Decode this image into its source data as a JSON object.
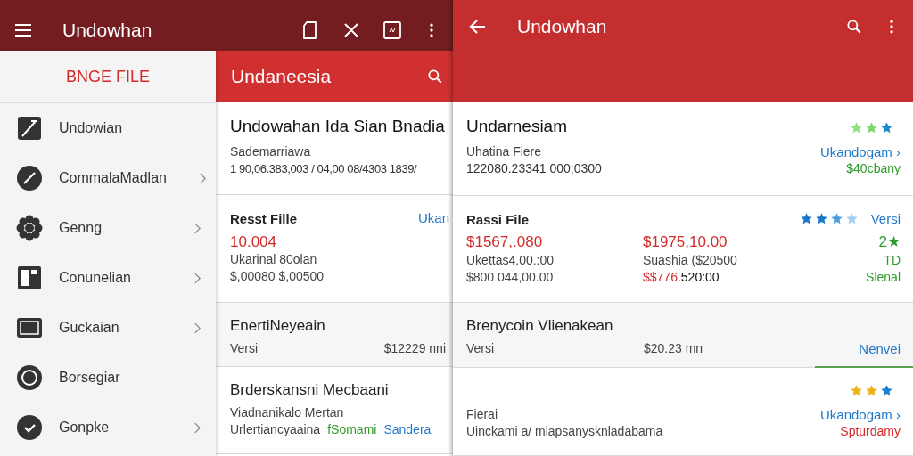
{
  "left_screen": {
    "app_bar": {
      "title": "Undowhan"
    },
    "drawer": {
      "header": "BNGE FILE",
      "items": [
        {
          "label": "Undowian",
          "chevron": false
        },
        {
          "label": "CommalaMadlan",
          "chevron": true
        },
        {
          "label": "Genng",
          "chevron": true
        },
        {
          "label": "Conunelian",
          "chevron": true
        },
        {
          "label": "Guckaian",
          "chevron": true
        },
        {
          "label": "Borsegiar",
          "chevron": false
        },
        {
          "label": "Gonpke",
          "chevron": true
        }
      ]
    },
    "content": {
      "header": "Undaneesia",
      "cards": [
        {
          "kind": "summary",
          "title": "Undowahan Ida Sian Bnadia",
          "subtitle": "Sademarriawa",
          "line": "1 90,06.383,003 / 04,00 08/4303 1839/"
        },
        {
          "kind": "price",
          "title": "Resst Fille",
          "link": "Ukan",
          "amount": "10.004",
          "lines": [
            "Ukarinal 80olan",
            "$,00080 $,00500"
          ]
        },
        {
          "kind": "version",
          "title": "EnertiNeyeain",
          "label": "Versi",
          "value": "$12229 nni"
        },
        {
          "kind": "detail",
          "title": "Brderskansni Mecbaani",
          "subtitle": "Viadnanikalo Mertan",
          "line": "Urlertiancyaaina",
          "tags": [
            {
              "text": "fSomami",
              "color": "#2e9b2a"
            },
            {
              "text": "Sandera",
              "color": "#1f78c8"
            }
          ]
        }
      ]
    }
  },
  "right_screen": {
    "app_bar": {
      "title": "Undowhan"
    },
    "cards": [
      {
        "kind": "summary",
        "title": "Undarnesiam",
        "star_icons": [
          {
            "color": "#8ee27e"
          },
          {
            "color": "#7fd46e"
          },
          {
            "color": "#1a8ad0"
          }
        ],
        "subtitle": "Uhatina Fiere",
        "line": "122080.23341 000;0300",
        "link": "Ukandogam ›",
        "note": {
          "text": "$40cbany",
          "color": "#2e9b2a"
        }
      },
      {
        "kind": "price",
        "title": "Rassi File",
        "star_icons": [
          {
            "color": "#1877c9"
          },
          {
            "color": "#1877c9"
          },
          {
            "color": "#4a9ee0"
          },
          {
            "color": "#a9cff0"
          }
        ],
        "link": "Versi",
        "columns": [
          {
            "lines": [
              [
                {
                  "text": "$1567,.080",
                  "color": "#d42a2a"
                }
              ],
              [
                {
                  "text": "Ukettas4.00.:00",
                  "color": "#444444"
                }
              ],
              [
                {
                  "text": "$800 044,00.00",
                  "color": "#444444"
                }
              ]
            ]
          },
          {
            "lines": [
              [
                {
                  "text": "$1975,10.00",
                  "color": "#d42a2a"
                }
              ],
              [
                {
                  "text": "Suashia ($20500",
                  "color": "#444444"
                }
              ],
              [
                {
                  "text": "$$776",
                  "color": "#d42a2a"
                },
                {
                  "text": ".520:00",
                  "color": "#111111"
                }
              ]
            ]
          },
          {
            "lines": [
              [
                {
                  "text": "2★",
                  "color": "#2e9b2a"
                }
              ],
              [
                {
                  "text": "TD",
                  "color": "#2e9b2a"
                }
              ],
              [
                {
                  "text": "Slenal",
                  "color": "#2e9b2a"
                }
              ]
            ]
          }
        ]
      },
      {
        "kind": "version",
        "title": "Brenycoin Vlienakean",
        "label": "Versi",
        "value": "$20.23 mn",
        "link": "Nenvei",
        "highlighted": true
      },
      {
        "kind": "detail",
        "star_icons": [
          {
            "color": "#f0b21a"
          },
          {
            "color": "#f0b21a"
          },
          {
            "color": "#1a7fcf"
          }
        ],
        "subtitle": "Fierai",
        "line": "Uinckami a/ mlapsanysknladabama",
        "link": "Ukandogam ›",
        "note": {
          "text": "Spturdamy",
          "color": "#d42a2a"
        }
      }
    ]
  }
}
